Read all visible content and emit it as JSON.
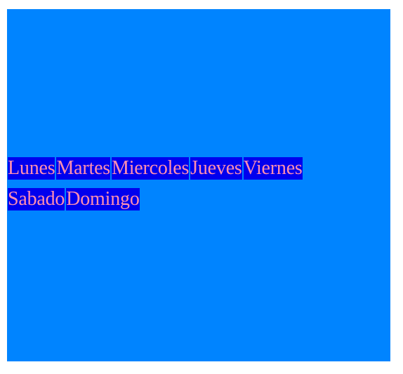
{
  "days": [
    {
      "label": "Lunes"
    },
    {
      "label": "Martes"
    },
    {
      "label": "Miercoles"
    },
    {
      "label": "Jueves"
    },
    {
      "label": "Viernes"
    },
    {
      "label": "Sabado"
    },
    {
      "label": "Domingo"
    }
  ],
  "colors": {
    "panel_background": "#0084ff",
    "item_background": "#0000ee",
    "item_text": "#ff8fb0"
  }
}
